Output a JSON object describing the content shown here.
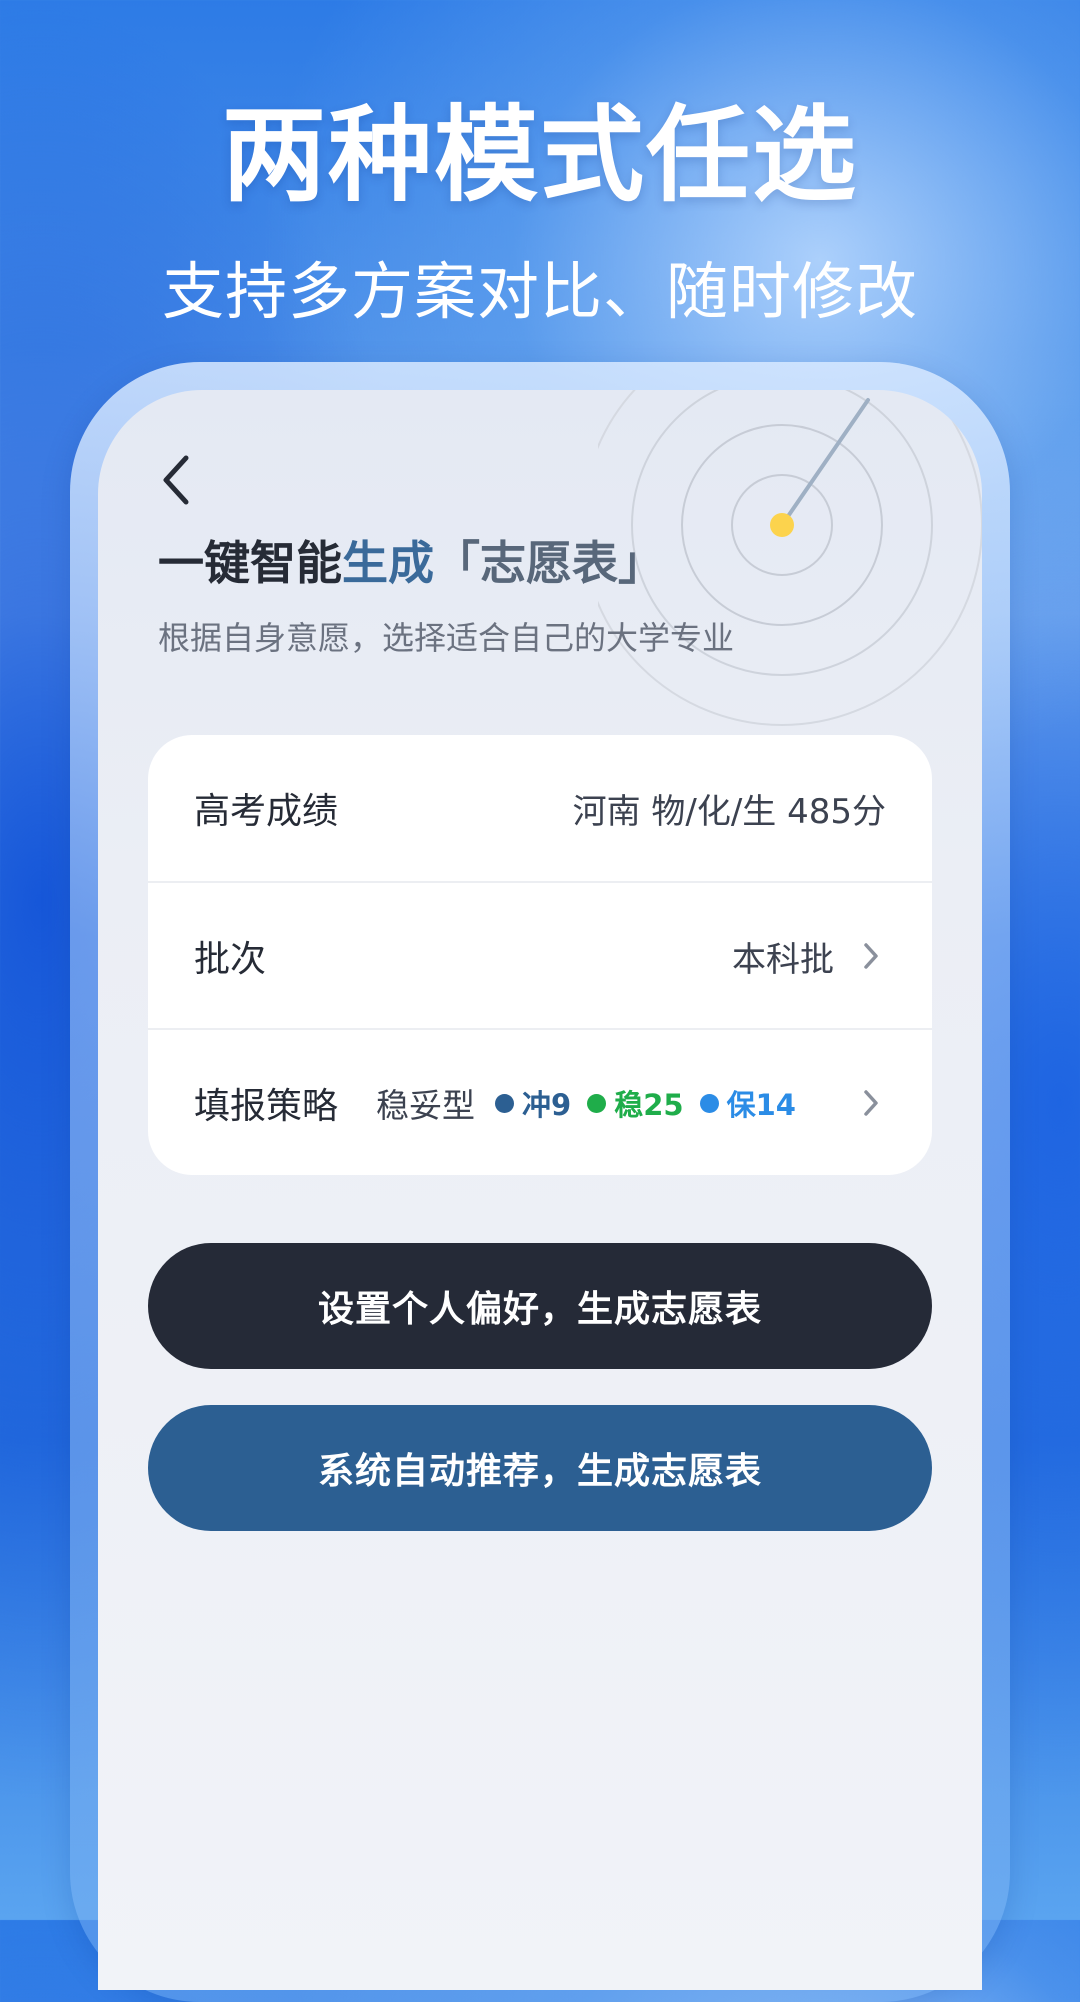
{
  "promo": {
    "headline": "两种模式任选",
    "subheadline": "支持多方案对比、随时修改"
  },
  "screen": {
    "title_part1": "一键智能",
    "title_part2": "生成",
    "title_part3": "「志愿表」",
    "subtitle": "根据自身意愿，选择适合自己的大学专业",
    "icons": {
      "back": "chevron-left-icon",
      "decoration": "radar-icon",
      "row_arrow": "chevron-right-icon"
    }
  },
  "form": {
    "score": {
      "label": "高考成绩",
      "value": "河南 物/化/生 485分"
    },
    "batch": {
      "label": "批次",
      "value": "本科批"
    },
    "strategy": {
      "label": "填报策略",
      "type": "稳妥型",
      "tags": [
        {
          "text": "冲9",
          "color": "#2c5f92"
        },
        {
          "text": "稳25",
          "color": "#1fad4a"
        },
        {
          "text": "保14",
          "color": "#2b8ce6"
        }
      ]
    }
  },
  "actions": {
    "preference_button": "设置个人偏好，生成志愿表",
    "auto_button": "系统自动推荐，生成志愿表"
  },
  "colors": {
    "dark_button": "#252a37",
    "blue_button": "#2c5f92",
    "radar_dot": "#fcd34d"
  }
}
